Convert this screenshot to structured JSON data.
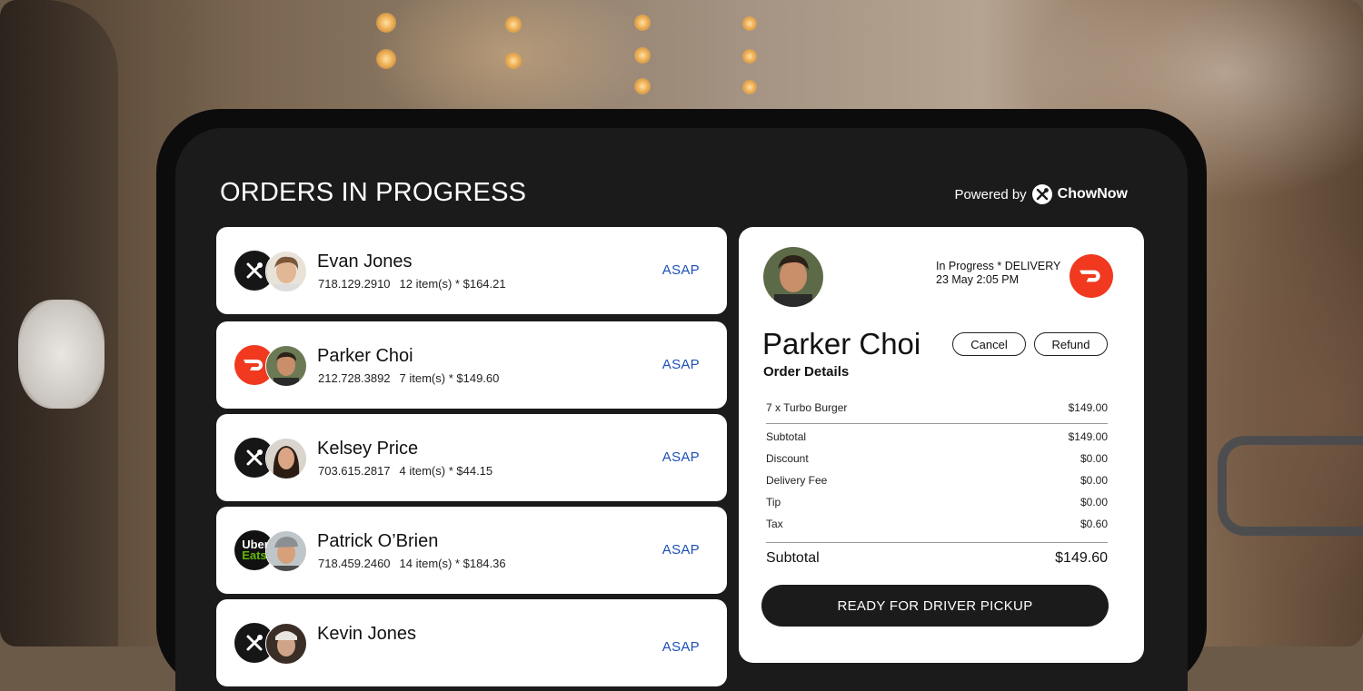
{
  "header": {
    "title": "ORDERS IN PROGRESS",
    "powered_prefix": "Powered by",
    "powered_brand": "ChowNow"
  },
  "orders": [
    {
      "name": "Evan Jones",
      "phone": "718.129.2910",
      "summary": "12 item(s) * $164.21",
      "time": "ASAP",
      "service": "chownow-icon"
    },
    {
      "name": "Parker Choi",
      "phone": "212.728.3892",
      "summary": "7 item(s) * $149.60",
      "time": "ASAP",
      "service": "doordash-icon"
    },
    {
      "name": "Kelsey Price",
      "phone": "703.615.2817",
      "summary": "4 item(s) * $44.15",
      "time": "ASAP",
      "service": "chownow-icon"
    },
    {
      "name": "Patrick O’Brien",
      "phone": "718.459.2460",
      "summary": "14 item(s) * $184.36",
      "time": "ASAP",
      "service": "ubereats-icon"
    },
    {
      "name": "Kevin Jones",
      "phone": "",
      "summary": "",
      "time": "ASAP",
      "service": "chownow-icon"
    }
  ],
  "detail": {
    "status_line1": "In Progress * DELIVERY",
    "status_line2": "23 May 2:05 PM",
    "name": "Parker Choi",
    "cancel_label": "Cancel",
    "refund_label": "Refund",
    "order_details_label": "Order Details",
    "items": [
      {
        "label": "7 x Turbo Burger",
        "amount": "$149.00"
      }
    ],
    "breakdown": [
      {
        "label": "Subtotal",
        "amount": "$149.00"
      },
      {
        "label": "Discount",
        "amount": "$0.00"
      },
      {
        "label": "Delivery Fee",
        "amount": "$0.00"
      },
      {
        "label": "Tip",
        "amount": "$0.00"
      },
      {
        "label": "Tax",
        "amount": "$0.60"
      }
    ],
    "total_label": "Subtotal",
    "total_amount": "$149.60",
    "cta_label": "READY FOR DRIVER PICKUP"
  },
  "colors": {
    "asap": "#1d4fb8",
    "doordash": "#f0391f",
    "ubereats_green": "#5fb709"
  },
  "ubereats_logo": {
    "line1": "Uber",
    "line2": "Eats"
  }
}
